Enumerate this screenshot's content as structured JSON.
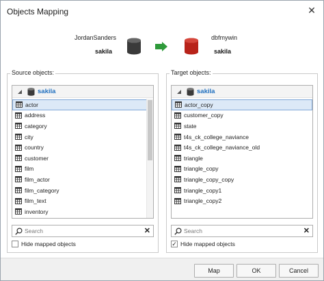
{
  "window": {
    "title": "Objects Mapping",
    "close_glyph": "✕"
  },
  "source_conn": {
    "user": "JordanSanders",
    "database": "sakila"
  },
  "target_conn": {
    "user": "dbfmywin",
    "database": "sakila"
  },
  "source_panel": {
    "label": "Source objects:",
    "root": "sakila",
    "items": [
      "actor",
      "address",
      "category",
      "city",
      "country",
      "customer",
      "film",
      "film_actor",
      "film_category",
      "film_text",
      "inventory"
    ],
    "selected_index": 0,
    "scroll_fraction_visible": 0.5,
    "search_placeholder": "Search",
    "hide_mapped_label": "Hide mapped objects",
    "hide_mapped_checked": false
  },
  "target_panel": {
    "label": "Target objects:",
    "root": "sakila",
    "items": [
      "actor_copy",
      "customer_copy",
      "state",
      "t4s_ck_college_naviance",
      "t4s_ck_college_naviance_old",
      "triangle",
      "triangle_copy",
      "triangle_copy_copy",
      "triangle_copy1",
      "triangle_copy2"
    ],
    "selected_index": 0,
    "search_placeholder": "Search",
    "hide_mapped_label": "Hide mapped objects",
    "hide_mapped_checked": true
  },
  "buttons": {
    "map": "Map",
    "ok": "OK",
    "cancel": "Cancel"
  },
  "colors": {
    "source_db": "#3a3a3a",
    "target_db": "#b8231a",
    "arrow": "#2e9a3a",
    "root_label": "#1f6fbf"
  }
}
